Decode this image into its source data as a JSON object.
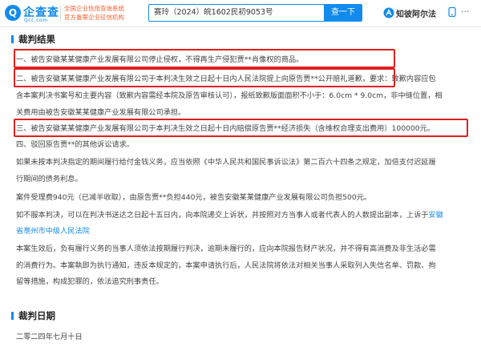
{
  "header": {
    "logo_mark": "Q",
    "logo_text": "企查查",
    "logo_sub": "Qcc.com",
    "tagline_1": "全国企业信用查询系统",
    "tagline_2": "官方备案企业征信机构",
    "search_value": "赛玲（2024）皖1602民初9053号",
    "search_button": "查一下",
    "brand_text": "知彼阿尔法",
    "more": "···",
    "colors": {
      "accent": "#128bed",
      "highlight_box": "#e02020",
      "tagline": "#f2612d"
    }
  },
  "verdict": {
    "title": "裁判结果",
    "items": [
      "一、被告安徽某某健康产业发展有限公司停止侵权，不得再生产侵犯贾**肖像权的商品。",
      "二、被告安徽某某健康产业发展有限公司于本判决生效之日起十日内人民法院提上向原告贾**公开赔礼道歉，要求：致歉内容应包",
      "含本案判决书案号和主要内容（致歉内容需经本院及原告审核认可），报纸致歉版面面积不小于：6.0cm * 9.0cm，非中缝位置，相",
      "关费用由被告安徽某某健康产业发展有限公司承担。",
      "三、被告安徽某某健康产业发展有限公司于本判决生效之日起十日内赔偿原告贾**经济损失（含维权合理支出费用）100000元。",
      "四、驳回原告贾**的其他诉讼请求。",
      "如果未按本判决指定的期间履行给付金钱义务，应当依照《中华人民共和国民事诉讼法》第二百六十四条之规定，加倍支付迟延履",
      "行期间的债务利息。",
      "案件受理费940元（已减半收取），由原告贾**负担440元，被告安徽某某健康产业发展有限公司负担500元。",
      "如不服本判决，可以在判决书送达之日起十五日内，向本院递交上诉状，并按照对方当事人或者代表人的人数提出副本，上诉于",
      "省亳州市中级人民法院。",
      "本案生效后，负有履行义务的当事人须依法按期履行判决，逾期未履行的，应向本院报告财产状况，并不得有高消费及非生活必需",
      "的消费行为。本案執即为执行通知，违反本规定的，本案申请执行后，人民法院将依法对相关当事人采取列入失信名单、罚款、拘",
      "留等措施，构成犯罪的，依法追究刑事责任。"
    ],
    "appeal_link_1": "安徽",
    "appeal_link_2": "省亳州市中级人民法院"
  },
  "judgment_date": {
    "title": "裁判日期",
    "value": "二零二四年七月十日"
  }
}
